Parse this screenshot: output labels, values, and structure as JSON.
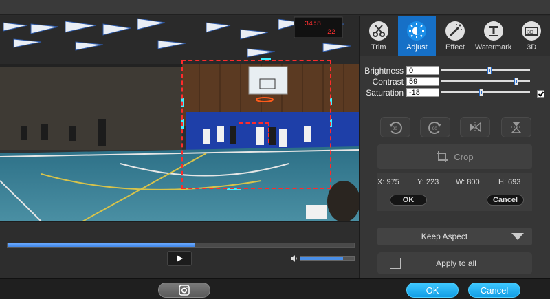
{
  "tabs": [
    {
      "label": "Trim",
      "icon": "scissors-icon"
    },
    {
      "label": "Adjust",
      "icon": "brightness-icon",
      "active": true
    },
    {
      "label": "Effect",
      "icon": "magic-wand-icon"
    },
    {
      "label": "Watermark",
      "icon": "watermark-icon"
    },
    {
      "label": "3D",
      "icon": "3d-icon"
    }
  ],
  "adjust": {
    "brightness_label": "Brightness",
    "brightness_value": "0",
    "contrast_label": "Contrast",
    "contrast_value": "59",
    "saturation_label": "Saturation",
    "saturation_value": "-18",
    "deinterlace_checked": true
  },
  "rotate": {
    "buttons": [
      "rotate-left-90-icon",
      "rotate-right-90-icon",
      "flip-horizontal-icon",
      "flip-vertical-icon"
    ],
    "left_label": "90",
    "right_label": "90"
  },
  "crop": {
    "button_label": "Crop",
    "x_label": "X: 975",
    "y_label": "Y: 223",
    "w_label": "W: 800",
    "h_label": "H: 693",
    "ok_label": "OK",
    "cancel_label": "Cancel"
  },
  "aspect": {
    "selected": "Keep Aspect"
  },
  "apply_all": {
    "label": "Apply to all",
    "checked": false
  },
  "player": {
    "progress": 0.54,
    "volume": 0.8
  },
  "footer": {
    "ok_label": "OK",
    "cancel_label": "Cancel"
  },
  "scoreboard": {
    "left": "34:8",
    "right": "22"
  },
  "colors": {
    "accent": "#1670c7",
    "crop_border": "#ff2b2b",
    "ok_blue": "#1ea8f0"
  }
}
